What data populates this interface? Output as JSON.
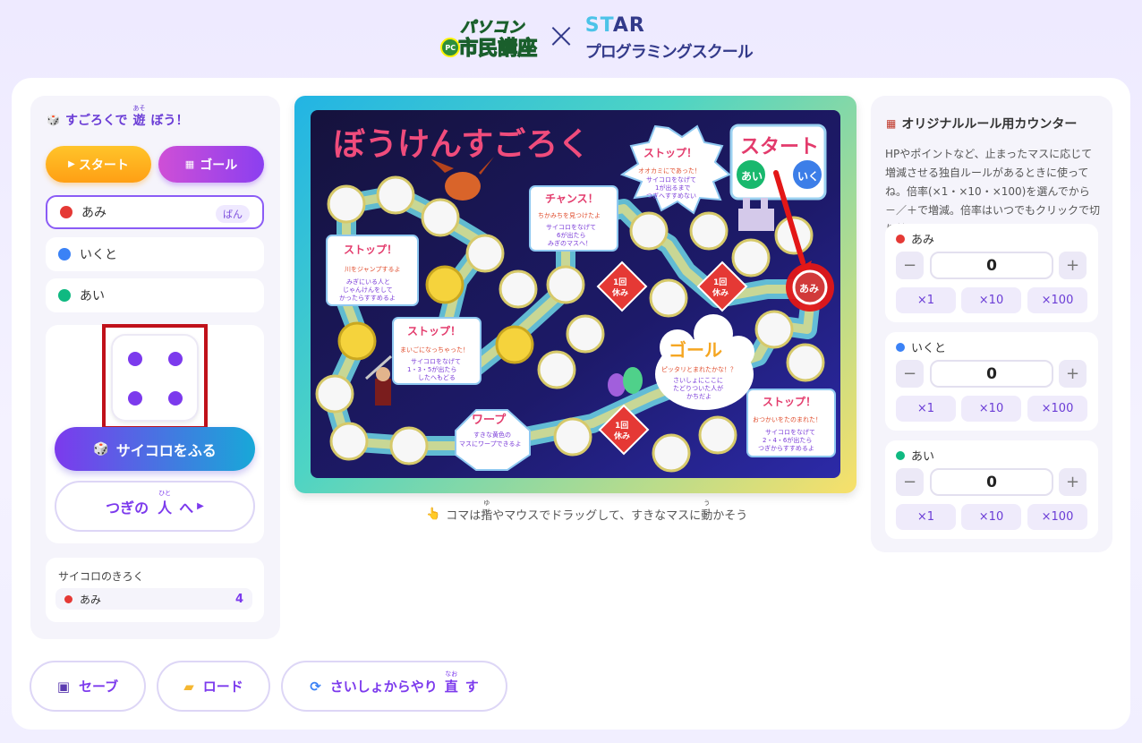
{
  "header": {
    "logo_left_line1": "パソコン",
    "logo_left_line2": "市民講座",
    "logo_left_badge": "PC",
    "times": "×",
    "logo_right_line1_a": "ST",
    "logo_right_line1_b": "AR",
    "logo_right_line2": "プログラミングスクール"
  },
  "left": {
    "title_pre": "すごろくで",
    "title_ruby_base": "遊",
    "title_ruby_text": "あそ",
    "title_post": "ぼう！",
    "start_label": "スタート",
    "goal_label": "ゴール",
    "players": [
      {
        "name": "あみ",
        "color": "#e53935",
        "badge": "ばん"
      },
      {
        "name": "いくと",
        "color": "#3b82f6"
      },
      {
        "name": "あい",
        "color": "#10b981"
      }
    ],
    "dice_value": 4,
    "roll_label": "サイコロをふる",
    "next_pre": "つぎの",
    "next_ruby_base": "人",
    "next_ruby_text": "ひと",
    "next_post": "へ",
    "log_title": "サイコロのきろく",
    "log": [
      {
        "name": "あみ",
        "value": "4"
      }
    ]
  },
  "board": {
    "title": "ぼうけんすごろく",
    "start": "スタート",
    "goal": "ゴール",
    "goal_text": "ピッタリとまれたかな！？",
    "goal_text2": "さいしょにここに",
    "goal_text3": "たどりついた人が",
    "goal_text4": "かちだよ",
    "piece_ai": "あい",
    "piece_iku": "いく",
    "piece_ami": "あみ",
    "rest": "1回",
    "rest2": "休み",
    "warp": "ワープ",
    "warp_text1": "すきな黄色の",
    "warp_text2": "マスにワープできるよ",
    "stop": "ストップ！",
    "chance": "チャンス！",
    "card1_1": "オオカミにであった！",
    "card1_2": "サイコロをなげて",
    "card1_3": "1が出るまで",
    "card1_4": "つぎへすすめない",
    "card2_1": "ちかみちを見つけたよ",
    "card2_2": "サイコロをなげて",
    "card2_3": "6が出たら",
    "card2_4": "みぎのマスへ！",
    "card3_1": "川をジャンプするよ",
    "card3_2": "みぎにいる人と",
    "card3_3": "じゃんけんをして",
    "card3_4": "かったらすすめるよ",
    "card4_1": "まいごになっちゃった！",
    "card4_2": "サイコロをなげて",
    "card4_3": "1・3・5が出たら",
    "card4_4": "したへもどる",
    "card5_1": "おつかいをたのまれた！",
    "card5_2": "サイコロをなげて",
    "card5_3": "2・4・6が出たら",
    "card5_4": "つぎからすすめるよ",
    "hint_pre": "コマは",
    "hint_ruby_base": "指",
    "hint_ruby_text": "ゆび",
    "hint_mid": "やマウスでドラッグして、すきなマスに",
    "hint_ruby2_base": "動",
    "hint_ruby2_text": "うご",
    "hint_post": "かそう"
  },
  "right": {
    "title": "オリジナルルール用カウンター",
    "title_ruby": "よう",
    "desc": "HPやポイントなど、止まったマスに応じて増減させる独自ルールがあるときに使ってね。倍率(×1・×10・×100)を選んでから－／＋で増減。倍率はいつでもクリックで切り替えOK。",
    "counters": [
      {
        "name": "あみ",
        "color": "#e53935",
        "value": "0"
      },
      {
        "name": "いくと",
        "color": "#3b82f6",
        "value": "0"
      },
      {
        "name": "あい",
        "color": "#10b981",
        "value": "0"
      }
    ],
    "minus": "−",
    "plus": "+",
    "mult1": "×1",
    "mult10": "×10",
    "mult100": "×100"
  },
  "bottom": {
    "save": "セーブ",
    "load": "ロード",
    "reset_pre": "さいしょからやり",
    "reset_ruby_base": "直",
    "reset_ruby_text": "なお",
    "reset_post": "す"
  }
}
